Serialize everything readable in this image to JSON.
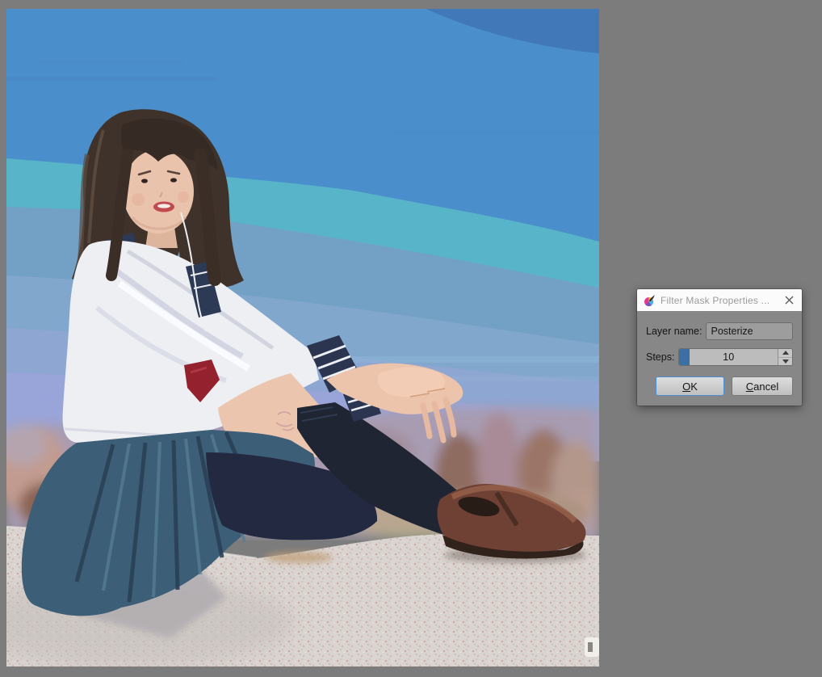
{
  "workspace": {
    "background_color": "#7c7c7c",
    "accent_blue": "#3c6fa5",
    "ok_focus_border": "#4a90d2"
  },
  "canvas": {
    "content": "posterized photo of a girl in a white sailor school uniform with red neckerchief, navy pleated skirt, dark knee socks and brown loafers, sitting on a speckled concrete ledge under a posterized blue sky with blurry trees at the horizon",
    "colors": {
      "sky_top": "#4a8fcb",
      "sky_teal_band": "#58b4c8",
      "sky_haze": "#99a4d8",
      "foliage": "#a89cb2",
      "ledge": "#dad4d0",
      "uniform_white": "#edeff3",
      "uniform_navy": "#3d5e77",
      "scarf_red": "#93222e",
      "sock_navy": "#1f2533",
      "shoe_brown": "#6e4134"
    }
  },
  "dialog": {
    "title": "Filter Mask Properties ...",
    "fields": {
      "layer_name": {
        "label": "Layer name:",
        "value": "Posterize"
      },
      "steps": {
        "label": "Steps:",
        "value": "10"
      }
    },
    "buttons": {
      "ok_mnemonic": "O",
      "ok_rest": "K",
      "cancel_mnemonic": "C",
      "cancel_rest": "ancel"
    }
  }
}
